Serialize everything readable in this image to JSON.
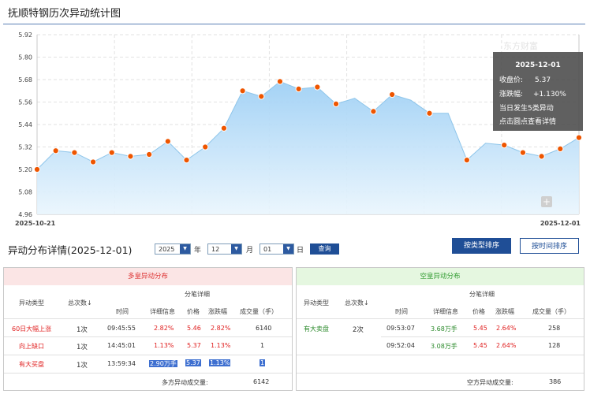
{
  "page_title": "抚顺特钢历次异动统计图",
  "chart_data": {
    "type": "area",
    "x_start_label": "2025-10-21",
    "x_end_label": "2025-12-01",
    "ylim": [
      4.96,
      5.92
    ],
    "yticks": [
      "5.92",
      "5.80",
      "5.68",
      "5.56",
      "5.44",
      "5.32",
      "5.20",
      "5.08",
      "4.96"
    ],
    "values": [
      5.2,
      5.3,
      5.29,
      5.24,
      5.29,
      5.27,
      5.28,
      5.35,
      5.25,
      5.32,
      5.42,
      5.62,
      5.59,
      5.67,
      5.63,
      5.64,
      5.55,
      5.58,
      5.51,
      5.6,
      5.57,
      5.5,
      5.5,
      5.25,
      5.34,
      5.33,
      5.29,
      5.27,
      5.31,
      5.37
    ],
    "markers": [
      0,
      1,
      2,
      3,
      4,
      5,
      6,
      7,
      8,
      9,
      10,
      11,
      12,
      13,
      14,
      15,
      16,
      18,
      19,
      21,
      23,
      25,
      26,
      27,
      28,
      29
    ],
    "line_color": "#8ec5ea",
    "marker_color": "#ee5500",
    "watermark": "东方财富",
    "tooltip": {
      "date": "2025-12-01",
      "close_label": "收盘价:",
      "close_value": "5.37",
      "change_label": "涨跌幅:",
      "change_value": "+1.130%",
      "line3": "当日发生5类异动",
      "line4": "点击圆点查看详情"
    }
  },
  "detail_title": "异动分布详情(2025-12-01)",
  "filters": {
    "year": "2025",
    "year_unit": "年",
    "month": "12",
    "month_unit": "月",
    "day": "01",
    "day_unit": "日",
    "query": "查询"
  },
  "sort_buttons": {
    "by_type": "按类型排序",
    "by_time": "按时间排序"
  },
  "panels": {
    "multi": {
      "title": "多皇异动分布",
      "headers": {
        "type": "异动类型",
        "count": "总次数↓",
        "group": "分笔详细",
        "time": "时间",
        "info": "详细信息",
        "price": "价格",
        "chg": "涨跌幅",
        "vol": "成交量（手）"
      },
      "rows": [
        {
          "type": "60日大幅上涨",
          "count": "1次",
          "time": "09:45:55",
          "info": "2.82%",
          "price": "5.46",
          "chg": "2.82%",
          "vol": "6140"
        },
        {
          "type": "向上缺口",
          "count": "1次",
          "time": "14:45:01",
          "info": "1.13%",
          "price": "5.37",
          "chg": "1.13%",
          "vol": "1"
        },
        {
          "type": "有大买盘",
          "count": "1次",
          "time": "13:59:34",
          "info": "2.90万手",
          "price": "5.37",
          "chg": "1.13%",
          "vol": "1"
        }
      ],
      "total_label": "多方异动成交量:",
      "total_value": "6142"
    },
    "short": {
      "title": "空皇异动分布",
      "headers": {
        "type": "异动类型",
        "count": "总次数↓",
        "group": "分笔详细",
        "time": "时间",
        "info": "详细信息",
        "price": "价格",
        "chg": "涨跌幅",
        "vol": "成交量（手）"
      },
      "group_type": "有大卖盘",
      "group_count": "2次",
      "rows": [
        {
          "time": "09:53:07",
          "info": "3.68万手",
          "price": "5.45",
          "chg": "2.64%",
          "vol": "258"
        },
        {
          "time": "09:52:04",
          "info": "3.08万手",
          "price": "5.45",
          "chg": "2.64%",
          "vol": "128"
        }
      ],
      "total_label": "空方异动成交量:",
      "total_value": "386"
    }
  }
}
